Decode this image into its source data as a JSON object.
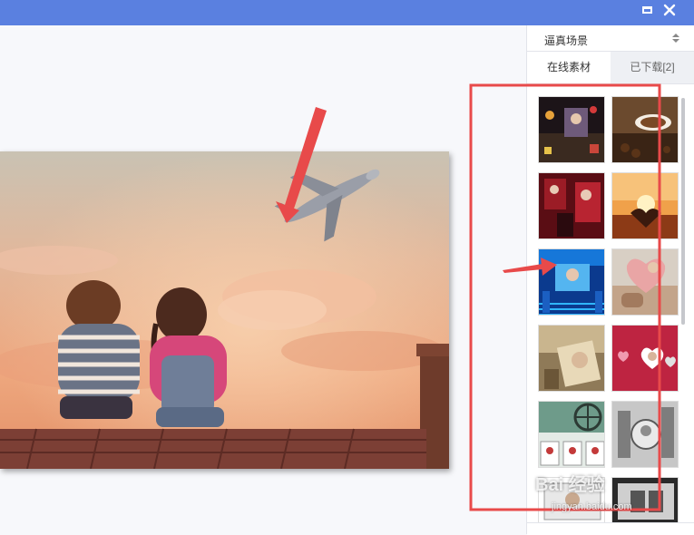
{
  "titlebar": {
    "color": "#5a80e0",
    "buttons": [
      {
        "name": "maximize",
        "icon": "maximize-icon"
      },
      {
        "name": "close",
        "icon": "close-icon",
        "glyph": "✕"
      }
    ]
  },
  "panel": {
    "dropdown": {
      "selected": "逼真场景"
    },
    "tabs": [
      {
        "label": "在线素材",
        "active": true
      },
      {
        "label": "已下载[2]",
        "active": false
      }
    ]
  },
  "annotation": {
    "highlight_color": "#e84a4a"
  },
  "watermark": {
    "text": "Bai 经验",
    "url": "jingyan.baidu.com"
  }
}
